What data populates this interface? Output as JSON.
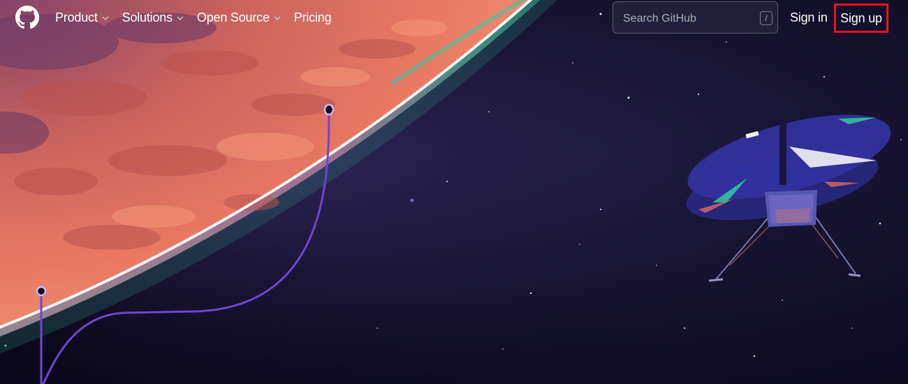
{
  "header": {
    "logo_icon": "github-octocat-icon",
    "nav": [
      {
        "label": "Product",
        "has_dropdown": true
      },
      {
        "label": "Solutions",
        "has_dropdown": true
      },
      {
        "label": "Open Source",
        "has_dropdown": true
      },
      {
        "label": "Pricing",
        "has_dropdown": false
      }
    ],
    "search": {
      "placeholder": "Search GitHub",
      "shortcut": "/"
    },
    "signin_label": "Sign in",
    "signup_label": "Sign up"
  },
  "hero": {
    "illustration": "mars-planet-with-helicopter-in-space"
  },
  "colors": {
    "background": "#0d0b1d",
    "planet": "#e0705a",
    "atmosphere_glow": "#ff8fb0",
    "path_line": "#6e45d6",
    "highlight_box": "#e8131f"
  }
}
